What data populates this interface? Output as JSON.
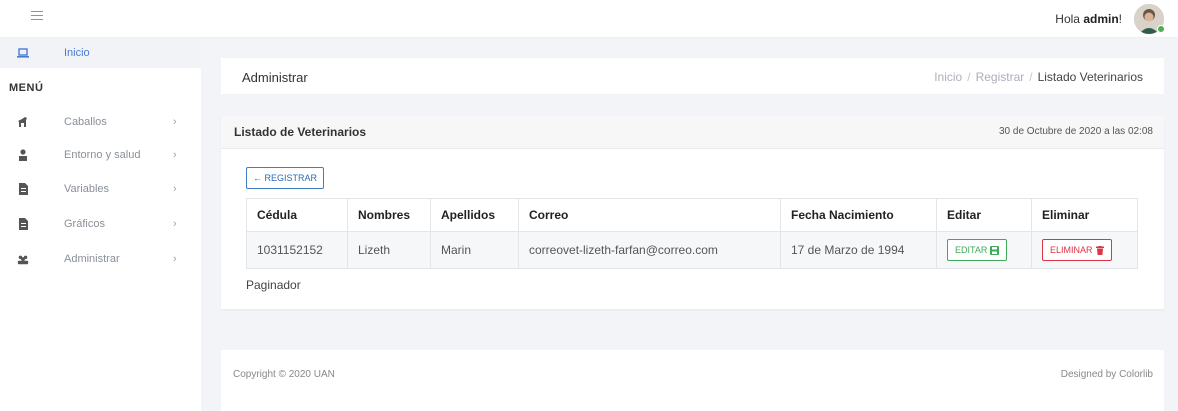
{
  "topbar": {
    "greeting_prefix": "Hola ",
    "username": "admin",
    "greeting_suffix": "!"
  },
  "sidebar": {
    "home": {
      "label": "Inicio",
      "icon": "laptop-icon"
    },
    "menu_heading": "MENÚ",
    "items": [
      {
        "label": "Caballos",
        "icon": "horse-icon",
        "chevron": "›"
      },
      {
        "label": "Entorno y salud",
        "icon": "user-icon",
        "chevron": "›"
      },
      {
        "label": "Variables",
        "icon": "file-icon",
        "chevron": "›"
      },
      {
        "label": "Gráficos",
        "icon": "file-icon",
        "chevron": "›"
      },
      {
        "label": "Administrar",
        "icon": "users-icon",
        "chevron": "›"
      }
    ]
  },
  "header": {
    "title": "Administrar",
    "breadcrumb": [
      "Inicio",
      "Registrar",
      "Listado Veterinarios"
    ],
    "separator": "/"
  },
  "card": {
    "title": "Listado de Veterinarios",
    "date": "30 de Octubre de 2020 a las 02:08",
    "register_button": "← REGISTRAR"
  },
  "table": {
    "columns": [
      "Cédula",
      "Nombres",
      "Apellidos",
      "Correo",
      "Fecha Nacimiento",
      "Editar",
      "Eliminar"
    ],
    "rows": [
      {
        "cedula": "1031152152",
        "nombres": "Lizeth",
        "apellidos": "Marin",
        "correo": "correovet-lizeth-farfan@correo.com",
        "fecha": "17 de Marzo de 1994",
        "edit_label": "EDITAR",
        "delete_label": "ELIMINAR"
      }
    ]
  },
  "paginator": "Paginador",
  "footer": {
    "copyright": "Copyright © 2020 UAN",
    "designed_by": "Designed by Colorlib"
  },
  "colors": {
    "accent_blue": "#3d7fc4",
    "edit_green": "#3eaa5a",
    "delete_red": "#dc3545",
    "background": "#f3f4f7"
  }
}
